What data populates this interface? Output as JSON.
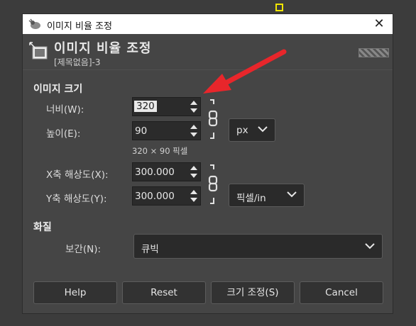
{
  "window": {
    "title": "이미지 비율 조정",
    "close_glyph": "✕"
  },
  "header": {
    "title": "이미지 비율 조정",
    "subtitle": "[제목없음]-3"
  },
  "image_size": {
    "section_label": "이미지 크기",
    "width_label": "너비(W):",
    "width_value": "320",
    "height_label": "높이(E):",
    "height_value": "90",
    "unit": "px",
    "pixel_info": "320 × 90 픽셀"
  },
  "resolution": {
    "x_label": "X축 해상도(X):",
    "x_value": "300.000",
    "y_label": "Y축 해상도(Y):",
    "y_value": "300.000",
    "unit": "픽셀/in"
  },
  "quality": {
    "section_label": "화질",
    "interp_label": "보간(N):",
    "interp_value": "큐빅"
  },
  "buttons": {
    "help": "Help",
    "reset": "Reset",
    "scale": "크기 조정(S)",
    "cancel": "Cancel"
  },
  "colors": {
    "annotation_arrow": "#e8262b",
    "guide": "#f2e600"
  },
  "icons": [
    "gimp-icon",
    "scale-image-icon",
    "chain-icon",
    "chevron-down-icon",
    "close-icon",
    "spin-up-icon",
    "spin-down-icon"
  ]
}
